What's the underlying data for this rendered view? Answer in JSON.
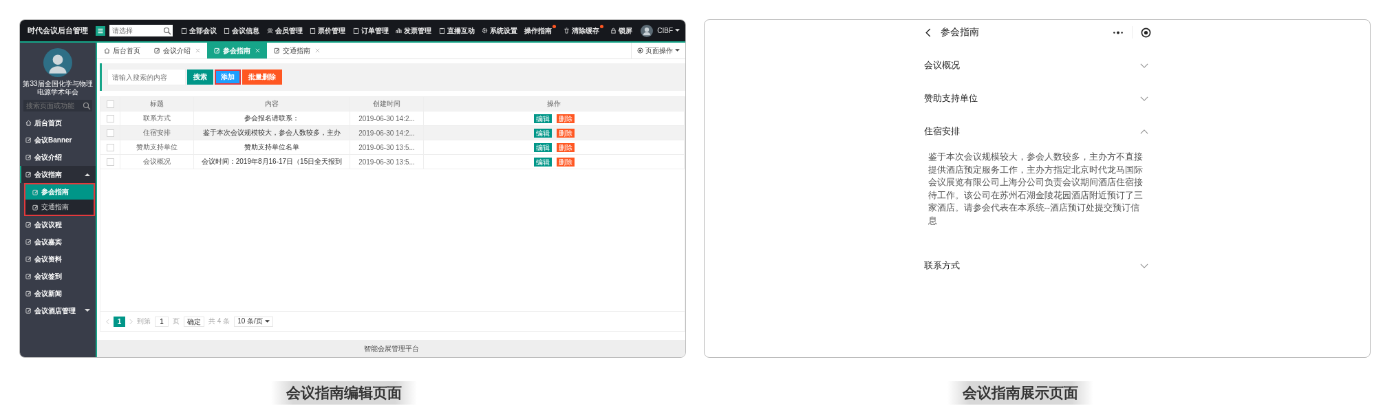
{
  "admin": {
    "app_title": "时代会议后台管理",
    "search": {
      "placeholder": "请选择"
    },
    "nav": [
      {
        "label": "全部会议",
        "kind": "doc",
        "dot": false
      },
      {
        "label": "会议信息",
        "kind": "doc",
        "dot": false
      },
      {
        "label": "会员管理",
        "kind": "users",
        "dot": false
      },
      {
        "label": "票价管理",
        "kind": "doc",
        "dot": false
      },
      {
        "label": "订单管理",
        "kind": "doc",
        "dot": false
      },
      {
        "label": "发票管理",
        "kind": "chart",
        "dot": false
      },
      {
        "label": "直播互动",
        "kind": "doc",
        "dot": false
      },
      {
        "label": "系统设置",
        "kind": "gear",
        "dot": false
      },
      {
        "label": "操作指南",
        "kind": "none",
        "dot": true
      },
      {
        "label": "清除缓存",
        "kind": "trash",
        "dot": true
      },
      {
        "label": "锁屏",
        "kind": "lock",
        "dot": false
      }
    ],
    "user": "CIBF",
    "sidebar": {
      "org_name": "第33届全国化学与物理电源学术年会",
      "search": {
        "placeholder": "搜索页面或功能"
      },
      "items": [
        {
          "label": "后台首页",
          "kind": "home",
          "selected": false
        },
        {
          "label": "会议Banner",
          "kind": "page",
          "selected": false
        },
        {
          "label": "会议介绍",
          "kind": "page",
          "selected": false
        },
        {
          "label": "会议指南",
          "kind": "group",
          "selected": false,
          "expanded": true,
          "outlined": true,
          "children": [
            {
              "label": "参会指南",
              "selected": true
            },
            {
              "label": "交通指南",
              "selected": false
            }
          ]
        },
        {
          "label": "会议议程",
          "kind": "page",
          "selected": false
        },
        {
          "label": "会议嘉宾",
          "kind": "page",
          "selected": false
        },
        {
          "label": "会议资料",
          "kind": "page",
          "selected": false
        },
        {
          "label": "会议签到",
          "kind": "page",
          "selected": false
        },
        {
          "label": "会议新闻",
          "kind": "page",
          "selected": false
        },
        {
          "label": "会议酒店管理",
          "kind": "group",
          "selected": false,
          "expanded": false
        }
      ]
    },
    "tabs": [
      {
        "label": "后台首页",
        "kind": "home",
        "selected": false,
        "closable": false
      },
      {
        "label": "会议介绍",
        "kind": "page",
        "selected": false,
        "closable": true
      },
      {
        "label": "参会指南",
        "kind": "page",
        "selected": true,
        "closable": true
      },
      {
        "label": "交通指南",
        "kind": "page",
        "selected": false,
        "closable": true
      }
    ],
    "page_actions": "页面操作",
    "toolbar": {
      "search": {
        "placeholder": "请输入搜索的内容"
      },
      "buttons": [
        {
          "label": "搜索",
          "kind": "primary",
          "outlined": false
        },
        {
          "label": "添加",
          "kind": "normal",
          "outlined": true
        },
        {
          "label": "批量删除",
          "kind": "danger",
          "outlined": false
        }
      ]
    },
    "table": {
      "all_checked": false,
      "columns": [
        "标题",
        "内容",
        "创建时间",
        "操作"
      ],
      "rows": [
        {
          "title": "联系方式",
          "content": "参会报名请联系：",
          "created": "2019-06-30 14:2...",
          "checked": false,
          "highlighted": false,
          "actions": [
            {
              "label": "编辑",
              "kind": "edit"
            },
            {
              "label": "删除",
              "kind": "delete"
            }
          ]
        },
        {
          "title": "住宿安排",
          "content": "鉴于本次会议规模较大，参会人数较多，主办",
          "created": "2019-06-30 14:2...",
          "checked": false,
          "highlighted": true,
          "actions": [
            {
              "label": "编辑",
              "kind": "edit"
            },
            {
              "label": "删除",
              "kind": "delete"
            }
          ]
        },
        {
          "title": "赞助支持单位",
          "content": "赞助支持单位名单",
          "created": "2019-06-30 13:5...",
          "checked": false,
          "highlighted": false,
          "actions": [
            {
              "label": "编辑",
              "kind": "edit"
            },
            {
              "label": "删除",
              "kind": "delete"
            }
          ]
        },
        {
          "title": "会议概况",
          "content": "会议时间：2019年8月16-17日（15日全天报到",
          "created": "2019-06-30 13:5...",
          "checked": false,
          "highlighted": false,
          "actions": [
            {
              "label": "编辑",
              "kind": "edit"
            },
            {
              "label": "删除",
              "kind": "delete"
            }
          ]
        }
      ]
    },
    "pagination": {
      "pages": [
        {
          "label": "1",
          "selected": true
        }
      ],
      "goto_label": "到第",
      "goto_value": "1",
      "page_unit": "页",
      "confirm": "确定",
      "total": "共 4 条",
      "page_size": "10 条/页"
    },
    "footer": "智能会展管理平台",
    "caption": "会议指南编辑页面"
  },
  "mobile": {
    "title": "参会指南",
    "sections": [
      {
        "title": "会议概况",
        "expanded": false
      },
      {
        "title": "赞助支持单位",
        "expanded": false
      },
      {
        "title": "住宿安排",
        "expanded": true,
        "body": "鉴于本次会议规模较大，参会人数较多，主办方不直接提供酒店预定服务工作，主办方指定北京时代龙马国际会议展览有限公司上海分公司负责会议期间酒店住宿接待工作。该公司在苏州石湖金陵花园酒店附近预订了三家酒店。请参会代表在本系统--酒店预订处提交预订信息"
      },
      {
        "title": "联系方式",
        "expanded": false
      }
    ],
    "caption": "会议指南展示页面"
  }
}
